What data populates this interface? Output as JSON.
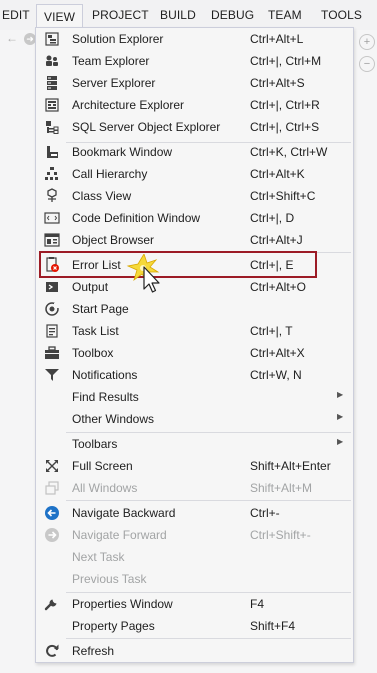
{
  "menubar": {
    "items": [
      "EDIT",
      "VIEW",
      "PROJECT",
      "BUILD",
      "DEBUG",
      "TEAM",
      "TOOLS"
    ],
    "active": "VIEW"
  },
  "view_menu": {
    "items": [
      {
        "label": "Solution Explorer",
        "shortcut": "Ctrl+Alt+L",
        "icon": "solution-explorer-icon"
      },
      {
        "label": "Team Explorer",
        "shortcut": "Ctrl+|, Ctrl+M",
        "icon": "team-explorer-icon"
      },
      {
        "label": "Server Explorer",
        "shortcut": "Ctrl+Alt+S",
        "icon": "server-explorer-icon"
      },
      {
        "label": "Architecture Explorer",
        "shortcut": "Ctrl+|, Ctrl+R",
        "icon": "architecture-explorer-icon"
      },
      {
        "label": "SQL Server Object Explorer",
        "shortcut": "Ctrl+|, Ctrl+S",
        "icon": "sql-server-icon"
      },
      {
        "label": "Bookmark Window",
        "shortcut": "Ctrl+K, Ctrl+W",
        "icon": "bookmark-icon"
      },
      {
        "label": "Call Hierarchy",
        "shortcut": "Ctrl+Alt+K",
        "icon": "call-hierarchy-icon"
      },
      {
        "label": "Class View",
        "shortcut": "Ctrl+Shift+C",
        "icon": "class-view-icon"
      },
      {
        "label": "Code Definition Window",
        "shortcut": "Ctrl+|, D",
        "icon": "code-definition-icon"
      },
      {
        "label": "Object Browser",
        "shortcut": "Ctrl+Alt+J",
        "icon": "object-browser-icon"
      },
      {
        "label": "Error List",
        "shortcut": "Ctrl+|, E",
        "icon": "error-list-icon"
      },
      {
        "label": "Output",
        "shortcut": "Ctrl+Alt+O",
        "icon": "output-icon"
      },
      {
        "label": "Start Page",
        "shortcut": "",
        "icon": "start-page-icon"
      },
      {
        "label": "Task List",
        "shortcut": "Ctrl+|, T",
        "icon": "task-list-icon"
      },
      {
        "label": "Toolbox",
        "shortcut": "Ctrl+Alt+X",
        "icon": "toolbox-icon"
      },
      {
        "label": "Notifications",
        "shortcut": "Ctrl+W, N",
        "icon": "notifications-icon"
      },
      {
        "label": "Find Results",
        "shortcut": "",
        "icon": ""
      },
      {
        "label": "Other Windows",
        "shortcut": "",
        "icon": ""
      },
      {
        "label": "Toolbars",
        "shortcut": "",
        "icon": ""
      },
      {
        "label": "Full Screen",
        "shortcut": "Shift+Alt+Enter",
        "icon": "full-screen-icon"
      },
      {
        "label": "All Windows",
        "shortcut": "Shift+Alt+M",
        "icon": "all-windows-icon"
      },
      {
        "label": "Navigate Backward",
        "shortcut": "Ctrl+-",
        "icon": "navigate-backward-icon"
      },
      {
        "label": "Navigate Forward",
        "shortcut": "Ctrl+Shift+-",
        "icon": "navigate-forward-icon"
      },
      {
        "label": "Next Task",
        "shortcut": "",
        "icon": ""
      },
      {
        "label": "Previous Task",
        "shortcut": "",
        "icon": ""
      },
      {
        "label": "Properties Window",
        "shortcut": "F4",
        "icon": "wrench-icon"
      },
      {
        "label": "Property Pages",
        "shortcut": "Shift+F4",
        "icon": ""
      },
      {
        "label": "Refresh",
        "shortcut": "",
        "icon": "refresh-icon"
      }
    ]
  },
  "colors": {
    "highlight_border": "#9c1b26",
    "disabled_text": "#a2a4a5",
    "navigate_blue": "#1e72c7"
  }
}
